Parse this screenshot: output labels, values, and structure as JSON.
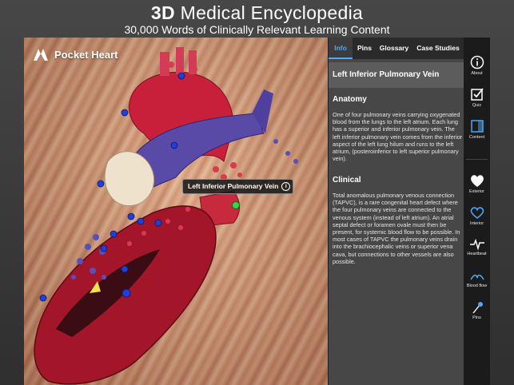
{
  "banner": {
    "title_bold": "3D",
    "title_rest": "Medical Encyclopedia",
    "subtitle": "30,000 Words of Clinically Relevant Learning Content"
  },
  "app": {
    "name": "Pocket Heart",
    "logo_icon": "heart-logo-icon"
  },
  "viewer": {
    "callout_label": "Left Inferior Pulmonary Vein",
    "callout_icon": "info-icon"
  },
  "tabs": [
    {
      "label": "Info",
      "active": true
    },
    {
      "label": "Pins",
      "active": false
    },
    {
      "label": "Glossary",
      "active": false
    },
    {
      "label": "Case Studies",
      "active": false
    }
  ],
  "panel": {
    "heading": "Left Inferior Pulmonary Vein",
    "anatomy_title": "Anatomy",
    "anatomy_text": "One of four pulmonary veins carrying oxygenated blood from the lungs to the left atrium. Each lung has a superior and inferior pulmonary vein. The left inferior pulmonary vein comes from the inferior aspect of the left lung hilum and runs to the left atrium, (posteroinferior to left superior pulmonary vein).",
    "clinical_title": "Clinical",
    "clinical_text": "Total anomalous pulmonary venous connection (TAPVC), is a rare congenital heart defect where the four pulmonary veins are connected to the venous system (instead of left atrium). An atrial septal defect or foramen ovale must then be present, for systemic blood flow to be possible. In most cases of TAPVC the pulmonary veins drain into the brachiocephalic veins or superior vena cava, but connections to other vessels are also possible."
  },
  "sidebar": [
    {
      "label": "About",
      "icon": "info-circle-icon"
    },
    {
      "label": "Quiz",
      "icon": "checkbox-icon"
    },
    {
      "label": "Content",
      "icon": "content-panel-icon"
    },
    {
      "label": "Exterior",
      "icon": "heart-filled-icon"
    },
    {
      "label": "Interior",
      "icon": "heart-outline-icon"
    },
    {
      "label": "Heartbeat",
      "icon": "pulse-icon"
    },
    {
      "label": "Blood flow",
      "icon": "blood-flow-icon"
    },
    {
      "label": "Pins",
      "icon": "pin-icon"
    }
  ],
  "colors": {
    "accent": "#4ea8f2",
    "panel_bg": "#474747",
    "sidebar_bg": "#1b1b1b",
    "aorta_red": "#c8203a",
    "vein_blue": "#5a4aa8"
  }
}
